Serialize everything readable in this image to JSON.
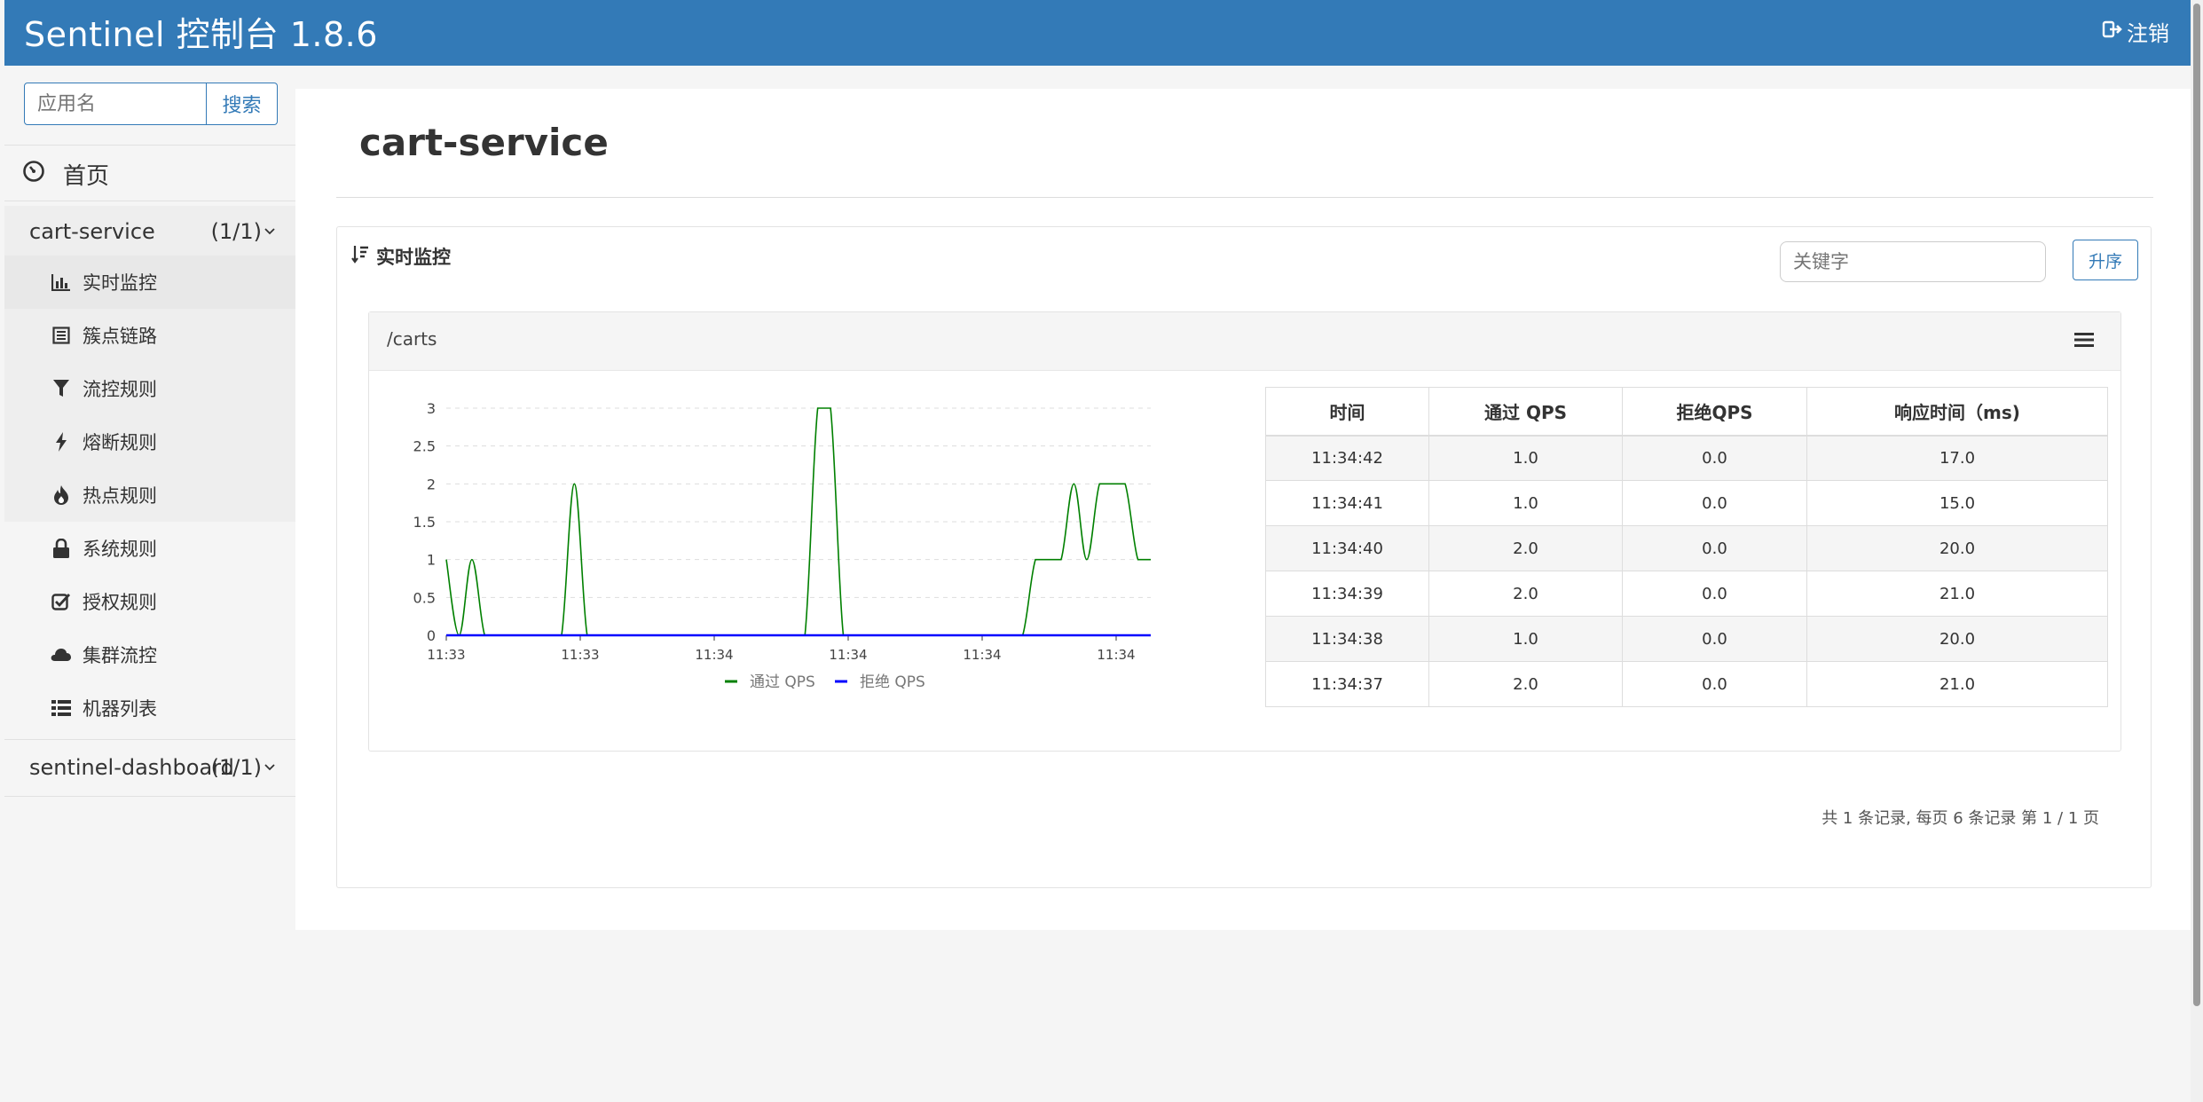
{
  "header": {
    "title": "Sentinel 控制台 1.8.6",
    "logout_label": "注销"
  },
  "sidebar": {
    "search_placeholder": "应用名",
    "search_button": "搜索",
    "home_label": "首页",
    "apps": [
      {
        "name": "cart-service",
        "count": "(1/1)"
      },
      {
        "name": "sentinel-dashboard",
        "count": "(1/1)"
      }
    ],
    "menu": [
      {
        "label": "实时监控",
        "icon": "bar-chart-icon"
      },
      {
        "label": "簇点链路",
        "icon": "list-alt-icon"
      },
      {
        "label": "流控规则",
        "icon": "filter-icon"
      },
      {
        "label": "熔断规则",
        "icon": "flash-icon"
      },
      {
        "label": "热点规则",
        "icon": "fire-icon"
      },
      {
        "label": "系统规则",
        "icon": "lock-icon"
      },
      {
        "label": "授权规则",
        "icon": "check-icon"
      },
      {
        "label": "集群流控",
        "icon": "cloud-icon"
      },
      {
        "label": "机器列表",
        "icon": "th-list-icon"
      }
    ]
  },
  "main": {
    "page_title": "cart-service",
    "panel_title": "实时监控",
    "keyword_placeholder": "关键字",
    "sort_button": "升序",
    "resource": {
      "name": "/carts"
    },
    "table": {
      "headers": [
        "时间",
        "通过 QPS",
        "拒绝QPS",
        "响应时间（ms)"
      ],
      "rows": [
        [
          "11:34:42",
          "1.0",
          "0.0",
          "17.0"
        ],
        [
          "11:34:41",
          "1.0",
          "0.0",
          "15.0"
        ],
        [
          "11:34:40",
          "2.0",
          "0.0",
          "20.0"
        ],
        [
          "11:34:39",
          "2.0",
          "0.0",
          "21.0"
        ],
        [
          "11:34:38",
          "1.0",
          "0.0",
          "20.0"
        ],
        [
          "11:34:37",
          "2.0",
          "0.0",
          "21.0"
        ]
      ]
    },
    "pager_text": "共 1 条记录, 每页 6 条记录 第 1 / 1 页"
  },
  "colors": {
    "header": "#337ab7",
    "pass_series": "#008000",
    "block_series": "#0000ff"
  },
  "chart_data": {
    "type": "line",
    "x_tick_labels": [
      "11:33",
      "11:33",
      "11:34",
      "11:34",
      "11:34",
      "11:34"
    ],
    "ylim": [
      0,
      3
    ],
    "y_ticks": [
      "0",
      "0.5",
      "1",
      "1.5",
      "2",
      "2.5",
      "3"
    ],
    "grid": true,
    "legend_position": "bottom",
    "x": [
      0,
      1,
      2,
      3,
      4,
      5,
      6,
      7,
      8,
      9,
      10,
      11,
      12,
      13,
      14,
      15,
      16,
      17,
      18,
      19,
      20,
      21,
      22,
      23,
      24,
      25,
      26,
      27,
      28,
      29,
      30,
      31,
      32,
      33,
      34,
      35,
      36,
      37,
      38,
      39,
      40,
      41,
      42,
      43,
      44,
      45,
      46,
      47,
      48,
      49,
      50,
      51,
      52,
      53,
      54,
      55
    ],
    "series": [
      {
        "name": "通过 QPS",
        "values": [
          1,
          0,
          1,
          0,
          0,
          0,
          0,
          0,
          0,
          0,
          2,
          0,
          0,
          0,
          0,
          0,
          0,
          0,
          0,
          0,
          0,
          0,
          0,
          0,
          0,
          0,
          0,
          0,
          0,
          3,
          3,
          0,
          0,
          0,
          0,
          0,
          0,
          0,
          0,
          0,
          0,
          0,
          0,
          0,
          0,
          0,
          1,
          1,
          1,
          2,
          1,
          2,
          2,
          2,
          1,
          1
        ]
      },
      {
        "name": "拒绝 QPS",
        "values": [
          0,
          0,
          0,
          0,
          0,
          0,
          0,
          0,
          0,
          0,
          0,
          0,
          0,
          0,
          0,
          0,
          0,
          0,
          0,
          0,
          0,
          0,
          0,
          0,
          0,
          0,
          0,
          0,
          0,
          0,
          0,
          0,
          0,
          0,
          0,
          0,
          0,
          0,
          0,
          0,
          0,
          0,
          0,
          0,
          0,
          0,
          0,
          0,
          0,
          0,
          0,
          0,
          0,
          0,
          0,
          0
        ]
      }
    ]
  }
}
